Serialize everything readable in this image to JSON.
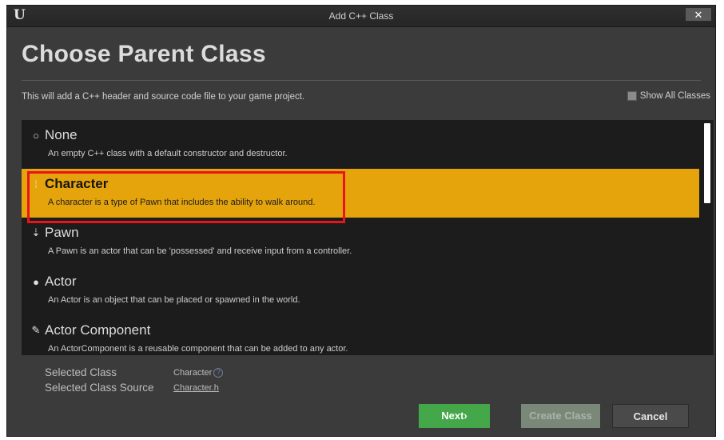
{
  "window": {
    "logo": "U",
    "title": "Add C++ Class",
    "close_label": "✕"
  },
  "header": {
    "heading": "Choose Parent Class",
    "description": "This will add a C++ header and source code file to your game project.",
    "show_all_label": "Show All Classes"
  },
  "classes": [
    {
      "icon": "circle-outline-icon",
      "glyph": "○",
      "name": "None",
      "description": "An empty C++ class with a default constructor and destructor.",
      "selected": false
    },
    {
      "icon": "character-icon",
      "glyph": "⁞",
      "name": "Character",
      "description": "A character is a type of Pawn that includes the ability to walk around.",
      "selected": true
    },
    {
      "icon": "pawn-icon",
      "glyph": "⇣",
      "name": "Pawn",
      "description": "A Pawn is an actor that can be 'possessed' and receive input from a controller.",
      "selected": false
    },
    {
      "icon": "actor-icon",
      "glyph": "●",
      "name": "Actor",
      "description": "An Actor is an object that can be placed or spawned in the world.",
      "selected": false
    },
    {
      "icon": "actor-component-icon",
      "glyph": "✎",
      "name": "Actor Component",
      "description": "An ActorComponent is a reusable component that can be added to any actor.",
      "selected": false
    }
  ],
  "selection": {
    "class_label": "Selected Class",
    "class_value": "Character",
    "source_label": "Selected Class Source",
    "source_value": "Character.h"
  },
  "buttons": {
    "next": "Next›",
    "create": "Create Class",
    "cancel": "Cancel"
  },
  "colors": {
    "selected_row": "#e6a40c",
    "highlight_box": "#e8141a",
    "next_button": "#44a84a"
  }
}
